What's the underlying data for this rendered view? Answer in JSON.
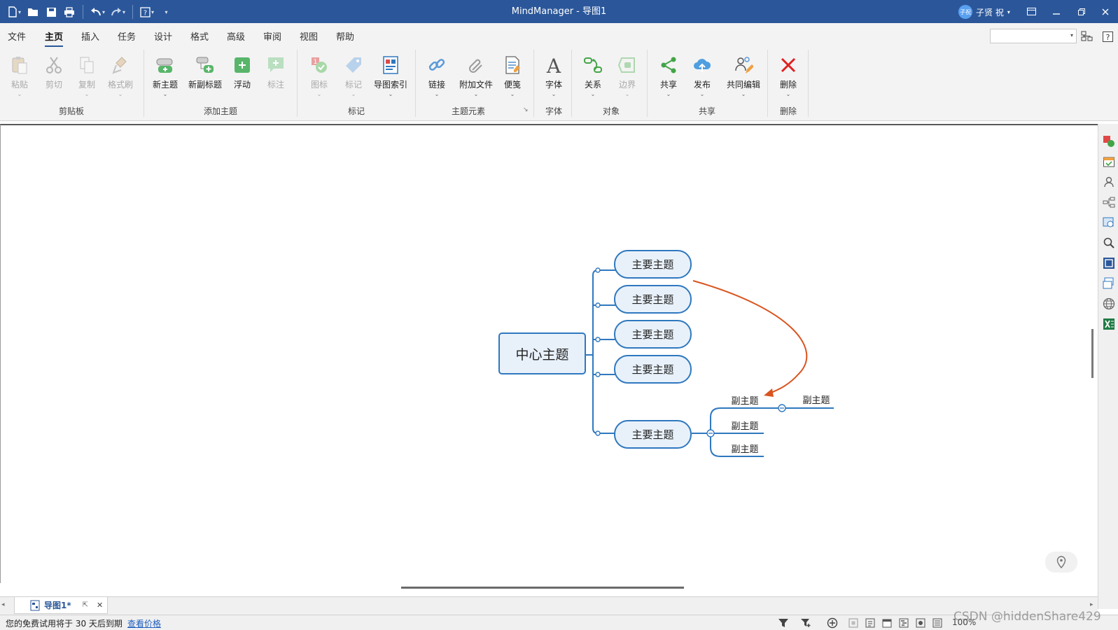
{
  "window": {
    "title": "MindManager - 导图1"
  },
  "user": {
    "avatar_text": "子祝",
    "name": "子贤 祝"
  },
  "menu": {
    "tabs": [
      {
        "label": "文件"
      },
      {
        "label": "主页"
      },
      {
        "label": "插入"
      },
      {
        "label": "任务"
      },
      {
        "label": "设计"
      },
      {
        "label": "格式"
      },
      {
        "label": "高级"
      },
      {
        "label": "审阅"
      },
      {
        "label": "视图"
      },
      {
        "label": "帮助"
      }
    ],
    "active_tab": "主页"
  },
  "ribbon": {
    "buttons": [
      {
        "label": "粘贴",
        "icon": "paste-icon",
        "disabled": true,
        "dropdown": true
      },
      {
        "label": "剪切",
        "icon": "scissors-icon",
        "disabled": true
      },
      {
        "label": "复制",
        "icon": "copy-icon",
        "disabled": true,
        "dropdown": true
      },
      {
        "label": "格式刷",
        "icon": "format-painter-icon",
        "disabled": true,
        "dropdown": true
      },
      {
        "label": "新主题",
        "icon": "new-topic-icon",
        "dropdown": true
      },
      {
        "label": "新副标题",
        "icon": "new-subtopic-icon"
      },
      {
        "label": "浮动",
        "icon": "floating-topic-icon"
      },
      {
        "label": "标注",
        "icon": "callout-icon",
        "disabled": true
      },
      {
        "label": "图标",
        "icon": "icon-marker-icon",
        "disabled": true,
        "dropdown": true
      },
      {
        "label": "标记",
        "icon": "tag-icon",
        "disabled": true,
        "dropdown": true
      },
      {
        "label": "导图索引",
        "icon": "map-index-icon",
        "dropdown": true
      },
      {
        "label": "链接",
        "icon": "link-icon",
        "dropdown": true
      },
      {
        "label": "附加文件",
        "icon": "attachment-icon",
        "dropdown": true
      },
      {
        "label": "便笺",
        "icon": "notes-icon",
        "dropdown": true
      },
      {
        "label": "字体",
        "icon": "font-icon",
        "dropdown": true
      },
      {
        "label": "关系",
        "icon": "relationship-icon",
        "dropdown": true
      },
      {
        "label": "边界",
        "icon": "boundary-icon",
        "disabled": true,
        "dropdown": true
      },
      {
        "label": "共享",
        "icon": "share-icon",
        "dropdown": true
      },
      {
        "label": "发布",
        "icon": "cloud-publish-icon",
        "dropdown": true
      },
      {
        "label": "共同编辑",
        "icon": "co-edit-icon",
        "dropdown": true
      },
      {
        "label": "删除",
        "icon": "delete-x-icon",
        "dropdown": true
      }
    ],
    "groups": [
      {
        "label": "剪贴板"
      },
      {
        "label": "添加主题"
      },
      {
        "label": "标记"
      },
      {
        "label": "主题元素"
      },
      {
        "label": "字体"
      },
      {
        "label": "对象"
      },
      {
        "label": "共享"
      },
      {
        "label": "删除"
      }
    ]
  },
  "mindmap": {
    "central": "中心主题",
    "main_topics": [
      "主要主题",
      "主要主题",
      "主要主题",
      "主要主题",
      "主要主题"
    ],
    "subtopics": [
      "副主题",
      "副主题",
      "副主题"
    ],
    "nested_subtopic": "副主题",
    "colors": {
      "line": "#2f78bf",
      "fill": "#e8f1fa",
      "relationship": "#d9541e"
    }
  },
  "document_tab": {
    "name": "导图1*"
  },
  "status": {
    "trial_text": "您的免费试用将于 30 天后到期",
    "price_link": "查看价格",
    "zoom": "100%"
  },
  "watermark": "CSDN @hiddenShare429",
  "colors": {
    "titlebar": "#2b579a",
    "ribbon_bg": "#f3f3f3",
    "accent": "#2b579a"
  }
}
